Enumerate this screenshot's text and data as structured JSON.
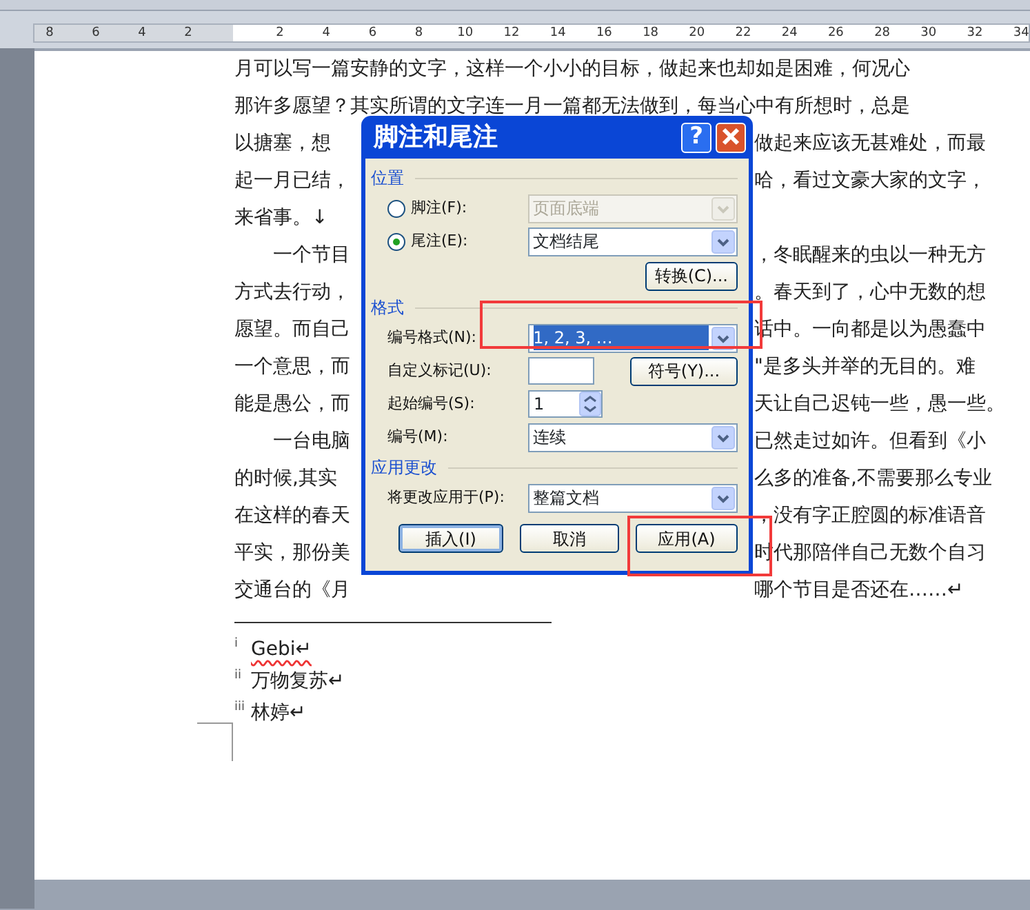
{
  "ruler": {
    "left_numbers": [
      "8",
      "6",
      "4",
      "2"
    ],
    "numbers": [
      "2",
      "4",
      "6",
      "8",
      "10",
      "12",
      "14",
      "16",
      "18",
      "20",
      "22",
      "24",
      "26",
      "28",
      "30",
      "32",
      "34"
    ]
  },
  "document": {
    "lines": [
      {
        "left": "月可以写一篇安静的文字，这样一个小小的目标，做起来也却如是困难，何况心",
        "indent": false
      },
      {
        "left": "那许多愿望？其实所谓的文字连一月一篇都无法做到，每当心中有所想时，总是",
        "indent": false
      },
      {
        "left": "以搪塞，想",
        "right": "做起来应该无甚难处，而最",
        "indent": false
      },
      {
        "left": "起一月已结，",
        "right": "哈，看过文豪大家的文字，",
        "indent": false
      },
      {
        "left": "来省事。↓",
        "indent": false
      },
      {
        "left": "一个节目",
        "right": "，冬眠醒来的虫以一种无方",
        "indent": true
      },
      {
        "left": "方式去行动，",
        "right": "。春天到了，心中无数的想",
        "indent": false
      },
      {
        "left": "愿望。而自己",
        "right": "话中。一向都是以为愚蠢中",
        "indent": false
      },
      {
        "left": "一个意思，而",
        "right": "\"是多头并举的无目的。难",
        "indent": false
      },
      {
        "left": "能是愚公，而",
        "right": "天让自己迟钝一些，愚一些。",
        "indent": false
      },
      {
        "left": "一台电脑",
        "right": "已然走过如许。但看到《小",
        "indent": true
      },
      {
        "left": "的时候,其实",
        "right": "么多的准备,不需要那么专业",
        "indent": false
      },
      {
        "left": "在这样的春天",
        "right": "，没有字正腔圆的标准语音",
        "indent": false
      },
      {
        "left": "平实，那份美",
        "right": "时代那陪伴自己无数个自习",
        "indent": false
      },
      {
        "left": "交通台的《月",
        "right": "哪个节目是否还在……↵",
        "indent": false
      }
    ],
    "endnotes": [
      {
        "mark": "i",
        "text": "Gebi↵",
        "misspelled": true
      },
      {
        "mark": "ii",
        "text": "万物复苏↵",
        "misspelled": false
      },
      {
        "mark": "iii",
        "text": "林婷↵",
        "misspelled": false
      }
    ]
  },
  "dialog": {
    "title": "脚注和尾注",
    "help": "?",
    "sections": [
      {
        "title": "位置",
        "rows": [
          {
            "kind": "radio",
            "label": "脚注(F):",
            "selected": false,
            "value": "页面底端",
            "disabled": true
          },
          {
            "kind": "radio",
            "label": "尾注(E):",
            "selected": true,
            "value": "文档结尾",
            "disabled": false
          },
          {
            "kind": "button",
            "button": "转换(C)..."
          }
        ]
      },
      {
        "title": "格式",
        "rows": [
          {
            "kind": "select",
            "label": "编号格式(N):",
            "value": "1, 2, 3, …",
            "highlighted": true
          },
          {
            "kind": "input",
            "label": "自定义标记(U):",
            "value": "",
            "button": "符号(Y)..."
          },
          {
            "kind": "spin",
            "label": "起始编号(S):",
            "value": "1"
          },
          {
            "kind": "select",
            "label": "编号(M):",
            "value": "连续",
            "highlighted": false
          }
        ]
      },
      {
        "title": "应用更改",
        "rows": [
          {
            "kind": "select",
            "label": "将更改应用于(P):",
            "value": "整篇文档",
            "highlighted": false
          }
        ]
      }
    ],
    "buttons": [
      {
        "label": "插入(I)",
        "default": true
      },
      {
        "label": "取消",
        "default": false
      },
      {
        "label": "应用(A)",
        "default": false
      }
    ]
  }
}
